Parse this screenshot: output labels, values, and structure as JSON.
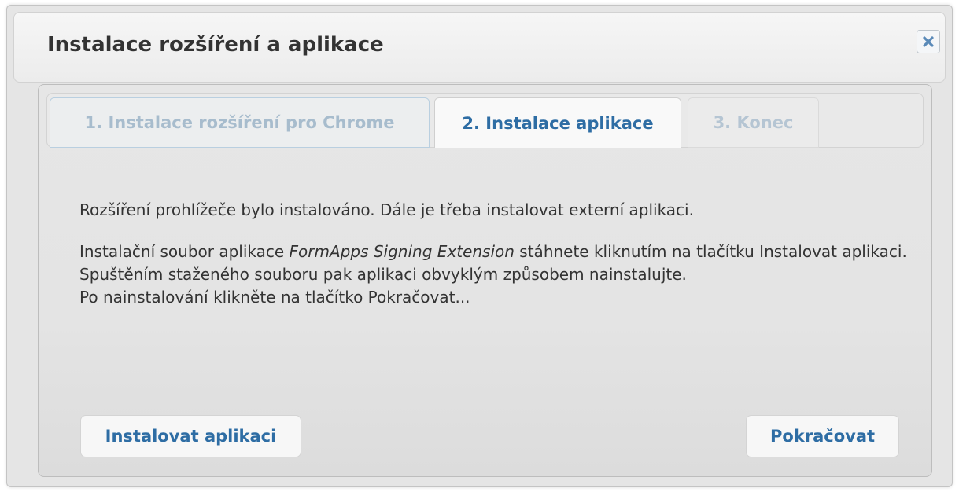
{
  "dialog": {
    "title": "Instalace rozšíření a aplikace",
    "close_icon": "close-x-icon"
  },
  "tabs": [
    {
      "label": "1. Instalace rozšíření pro Chrome",
      "state": "inactive"
    },
    {
      "label": "2. Instalace aplikace",
      "state": "active"
    },
    {
      "label": "3. Konec",
      "state": "disabled"
    }
  ],
  "content": {
    "line1": "Rozšíření prohlížeče bylo instalováno. Dále je třeba instalovat externí aplikaci.",
    "para2_before_italic": "Instalační soubor aplikace ",
    "para2_italic": "FormApps Signing Extension",
    "para2_after_italic": " stáhnete kliknutím na tlačítku Instalovat aplikaci. Spuštěním staženého souboru pak aplikaci obvyklým způsobem nainstalujte.",
    "para3": "Po nainstalování klikněte na tlačítko Pokračovat..."
  },
  "buttons": {
    "install_label": "Instalovat aplikaci",
    "continue_label": "Pokračovat"
  },
  "colors": {
    "accent": "#2e6da4",
    "close_icon": "#5a8ab8"
  }
}
